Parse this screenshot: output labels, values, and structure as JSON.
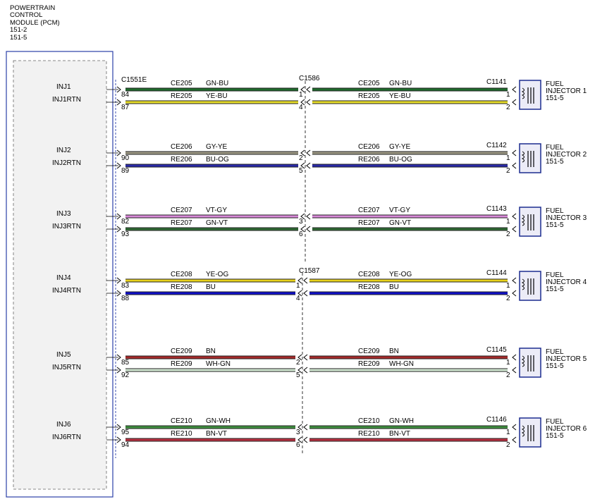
{
  "pcm": {
    "title_lines": [
      "POWERTRAIN",
      "CONTROL",
      "MODULE (PCM)",
      "151-2",
      "151-5"
    ]
  },
  "connectors": {
    "pcm_side": "C1551E",
    "inline_a": "C1586",
    "inline_b": "C1587"
  },
  "injectors": [
    {
      "pin_label": "INJ1",
      "rtn_label": "INJ1RTN",
      "pcm_pin_top": "84",
      "pcm_pin_bottom": "87",
      "inline_pin_top": "1",
      "inline_pin_bottom": "4",
      "inj_pin_top": "1",
      "inj_pin_bottom": "2",
      "connector": "C1141",
      "name_lines": [
        "FUEL",
        "INJECTOR 1",
        "151-5"
      ],
      "wire_top": {
        "circuit": "CE205",
        "color_code": "GN-BU",
        "stroke": "#1f6b2c"
      },
      "wire_bottom": {
        "circuit": "RE205",
        "color_code": "YE-BU",
        "stroke": "#e6dc2a"
      }
    },
    {
      "pin_label": "INJ2",
      "rtn_label": "INJ2RTN",
      "pcm_pin_top": "90",
      "pcm_pin_bottom": "89",
      "inline_pin_top": "2",
      "inline_pin_bottom": "5",
      "inj_pin_top": "1",
      "inj_pin_bottom": "2",
      "connector": "C1142",
      "name_lines": [
        "FUEL",
        "INJECTOR 2",
        "151-5"
      ],
      "wire_top": {
        "circuit": "CE206",
        "color_code": "GY-YE",
        "stroke": "#9c9884"
      },
      "wire_bottom": {
        "circuit": "RE206",
        "color_code": "BU-OG",
        "stroke": "#2a2aa8"
      }
    },
    {
      "pin_label": "INJ3",
      "rtn_label": "INJ3RTN",
      "pcm_pin_top": "82",
      "pcm_pin_bottom": "93",
      "inline_pin_top": "3",
      "inline_pin_bottom": "6",
      "inj_pin_top": "1",
      "inj_pin_bottom": "2",
      "connector": "C1143",
      "name_lines": [
        "FUEL",
        "INJECTOR 3",
        "151-5"
      ],
      "wire_top": {
        "circuit": "CE207",
        "color_code": "VT-GY",
        "stroke": "#d98ad9"
      },
      "wire_bottom": {
        "circuit": "RE207",
        "color_code": "GN-VT",
        "stroke": "#2f6a34"
      }
    },
    {
      "pin_label": "INJ4",
      "rtn_label": "INJ4RTN",
      "pcm_pin_top": "83",
      "pcm_pin_bottom": "88",
      "inline_pin_top": "1",
      "inline_pin_bottom": "4",
      "inj_pin_top": "1",
      "inj_pin_bottom": "2",
      "connector": "C1144",
      "name_lines": [
        "FUEL",
        "INJECTOR 4",
        "151-5"
      ],
      "wire_top": {
        "circuit": "CE208",
        "color_code": "YE-OG",
        "stroke": "#e8d21c"
      },
      "wire_bottom": {
        "circuit": "RE208",
        "color_code": "BU",
        "stroke": "#1010c8"
      }
    },
    {
      "pin_label": "INJ5",
      "rtn_label": "INJ5RTN",
      "pcm_pin_top": "85",
      "pcm_pin_bottom": "92",
      "inline_pin_top": "2",
      "inline_pin_bottom": "5",
      "inj_pin_top": "1",
      "inj_pin_bottom": "2",
      "connector": "C1145",
      "name_lines": [
        "FUEL",
        "INJECTOR 5",
        "151-5"
      ],
      "wire_top": {
        "circuit": "CE209",
        "color_code": "BN",
        "stroke": "#a52a2a"
      },
      "wire_bottom": {
        "circuit": "RE209",
        "color_code": "WH-GN",
        "stroke": "#d2e8d2"
      }
    },
    {
      "pin_label": "INJ6",
      "rtn_label": "INJ6RTN",
      "pcm_pin_top": "95",
      "pcm_pin_bottom": "94",
      "inline_pin_top": "3",
      "inline_pin_bottom": "6",
      "inj_pin_top": "1",
      "inj_pin_bottom": "2",
      "connector": "C1146",
      "name_lines": [
        "FUEL",
        "INJECTOR 6",
        "151-5"
      ],
      "wire_top": {
        "circuit": "CE210",
        "color_code": "GN-WH",
        "stroke": "#3f8f3f"
      },
      "wire_bottom": {
        "circuit": "RE210",
        "color_code": "BN-VT",
        "stroke": "#b83040"
      }
    }
  ]
}
